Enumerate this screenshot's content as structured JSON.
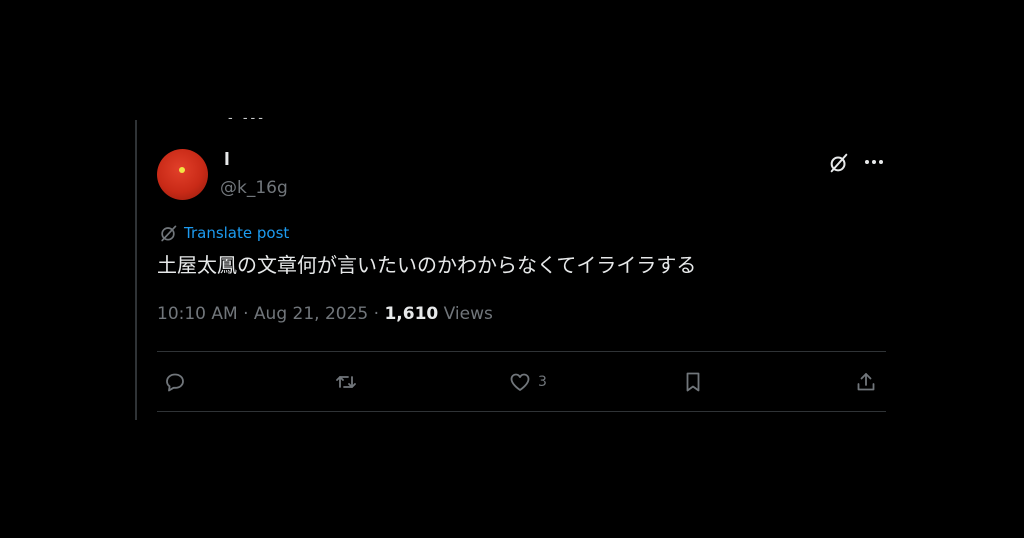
{
  "thread": {
    "cut_text": "- ---"
  },
  "author": {
    "display_name": "l",
    "handle": "@k_16g"
  },
  "icons": {
    "grok": "grok-icon",
    "more": "more-icon",
    "translate": "globe-slash-icon",
    "reply": "reply-icon",
    "repost": "repost-icon",
    "like": "heart-icon",
    "bookmark": "bookmark-icon",
    "share": "share-icon"
  },
  "post": {
    "translate_label": "Translate post",
    "text": "土屋太鳳の文章何が言いたいのかわからなくてイライラする",
    "time": "10:10 AM",
    "sep1": " · ",
    "date": "Aug 21, 2025",
    "sep2": " · ",
    "views_count": "1,610",
    "views_label": " Views"
  },
  "actions": {
    "like_count": "3"
  },
  "colors": {
    "accent": "#1d9bf0",
    "muted": "#71767b",
    "text": "#e7e9ea",
    "border": "#2f3336"
  }
}
